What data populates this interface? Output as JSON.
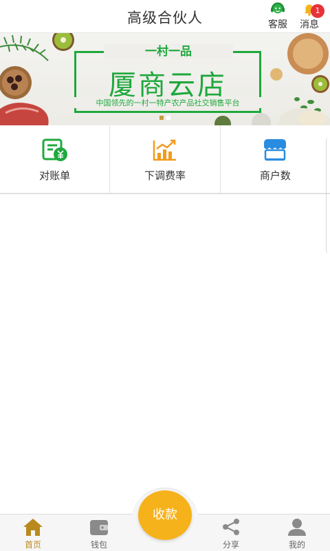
{
  "header": {
    "title": "高级合伙人",
    "service_label": "客服",
    "message_label": "消息",
    "message_badge": "1"
  },
  "banner": {
    "subtitle": "一村一品",
    "title": "厦商云店",
    "tagline": "中国领先的一村一特产农产品社交销售平台",
    "page_count": 2,
    "active_page": 1
  },
  "functions": [
    {
      "label": "对账单",
      "icon": "statement-icon"
    },
    {
      "label": "下调费率",
      "icon": "rate-chart-icon"
    },
    {
      "label": "商户数",
      "icon": "store-icon"
    }
  ],
  "bottom_nav": {
    "home": "首页",
    "wallet": "钱包",
    "collect": "收款",
    "share": "分享",
    "mine": "我的"
  },
  "colors": {
    "accent_green": "#1ea83c",
    "accent_gold": "#f6b21a",
    "badge_red": "#e8323a",
    "icon_blue": "#2a8ce0",
    "icon_orange": "#f39a1e"
  }
}
